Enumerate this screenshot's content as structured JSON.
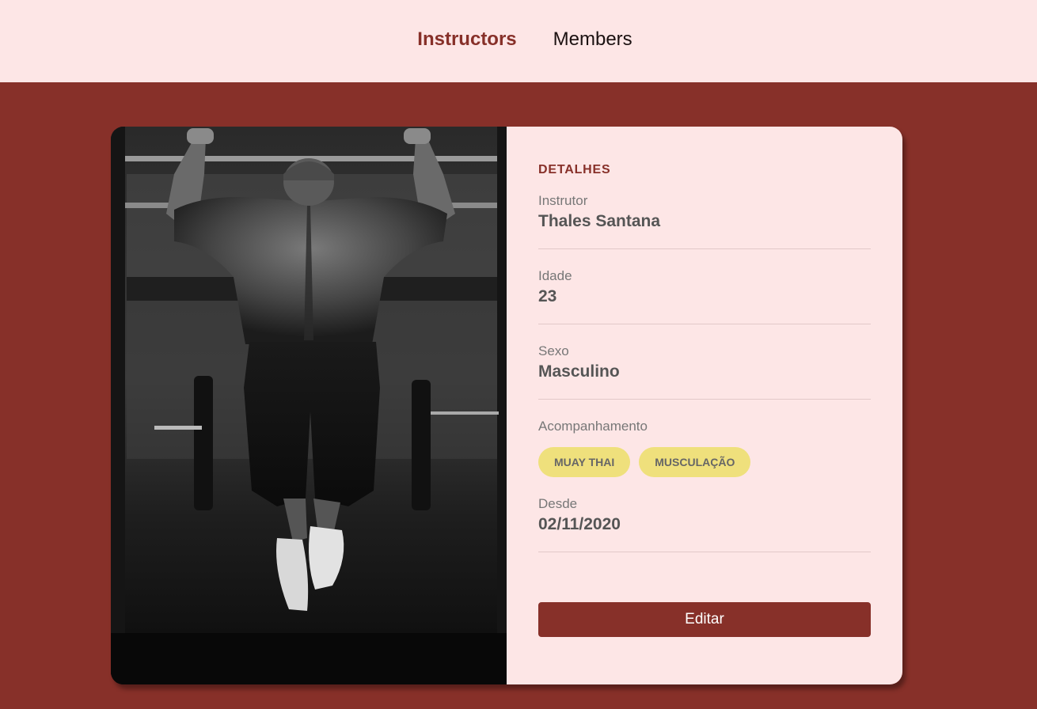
{
  "nav": {
    "items": [
      {
        "label": "Instructors",
        "active": true
      },
      {
        "label": "Members",
        "active": false
      }
    ]
  },
  "colors": {
    "brand": "#873029",
    "background_light": "#fde6e6",
    "tag": "#efe07c"
  },
  "details": {
    "title": "DETALHES",
    "fields": [
      {
        "label": "Instrutor",
        "value": "Thales Santana"
      },
      {
        "label": "Idade",
        "value": "23"
      },
      {
        "label": "Sexo",
        "value": "Masculino"
      },
      {
        "label": "Acompanhamento",
        "tags": [
          "Muay Thai",
          "Musculação"
        ]
      },
      {
        "label": "Desde",
        "value": "02/11/2020"
      }
    ],
    "edit_label": "Editar"
  }
}
